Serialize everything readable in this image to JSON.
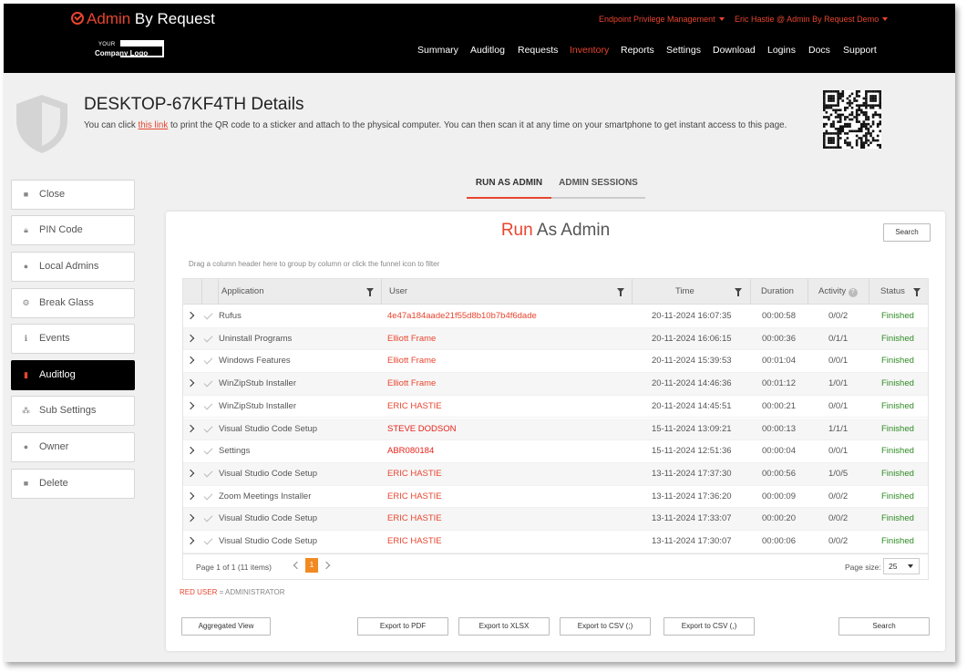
{
  "brand": {
    "name_accent": "Admin",
    "name_rest": " By Request"
  },
  "company_logo": {
    "your": "YOUR",
    "text": "Company Logo"
  },
  "top_links": {
    "product": "Endpoint Privilege Management",
    "user": "Eric Hastie @ Admin By Request Demo"
  },
  "nav": [
    "Summary",
    "Auditlog",
    "Requests",
    "Inventory",
    "Reports",
    "Settings",
    "Download",
    "Logins",
    "Docs",
    "Support"
  ],
  "nav_active": "Inventory",
  "page": {
    "title": "DESKTOP-67KF4TH Details",
    "subtitle_before": "You can click ",
    "subtitle_link": "this link",
    "subtitle_after": " to print the QR code to a sticker and attach to the physical computer. You can then scan it at any time on your smartphone to get instant access to this page."
  },
  "sidebar": [
    {
      "label": "Close",
      "icon": "square-icon"
    },
    {
      "label": "PIN Code",
      "icon": "lock-icon"
    },
    {
      "label": "Local Admins",
      "icon": "user-icon"
    },
    {
      "label": "Break Glass",
      "icon": "gears-icon"
    },
    {
      "label": "Events",
      "icon": "info-icon"
    },
    {
      "label": "Auditlog",
      "icon": "document-icon",
      "active": true
    },
    {
      "label": "Sub Settings",
      "icon": "sitemap-icon"
    },
    {
      "label": "Owner",
      "icon": "user-icon"
    },
    {
      "label": "Delete",
      "icon": "square-icon"
    }
  ],
  "tabs": [
    "RUN AS ADMIN",
    "ADMIN SESSIONS"
  ],
  "panel": {
    "title_accent": "Run",
    "title_rest": " As Admin",
    "search_label": "Search",
    "hint": "Drag a column header here to group by column or click the funnel icon to filter"
  },
  "grid": {
    "columns": {
      "application": "Application",
      "user": "User",
      "time": "Time",
      "duration": "Duration",
      "activity": "Activity",
      "status": "Status"
    },
    "rows": [
      {
        "application": "Rufus",
        "user": "4e47a184aade21f55d8b10b7b4f6dade",
        "time": "20-11-2024 16:07:35",
        "duration": "00:00:58",
        "activity": "0/0/2",
        "status": "Finished"
      },
      {
        "application": "Uninstall Programs",
        "user": "Elliott Frame",
        "time": "20-11-2024 16:06:15",
        "duration": "00:00:36",
        "activity": "0/1/1",
        "status": "Finished"
      },
      {
        "application": "Windows Features",
        "user": "Elliott Frame",
        "time": "20-11-2024 15:39:53",
        "duration": "00:01:04",
        "activity": "0/0/1",
        "status": "Finished"
      },
      {
        "application": "WinZipStub Installer",
        "user": "Elliott Frame",
        "time": "20-11-2024 14:46:36",
        "duration": "00:01:12",
        "activity": "1/0/1",
        "status": "Finished"
      },
      {
        "application": "WinZipStub Installer",
        "user": "ERIC HASTIE",
        "time": "20-11-2024 14:45:51",
        "duration": "00:00:21",
        "activity": "0/0/1",
        "status": "Finished"
      },
      {
        "application": "Visual Studio Code Setup",
        "user": "STEVE DODSON",
        "time": "15-11-2024 13:09:21",
        "duration": "00:00:13",
        "activity": "1/1/1",
        "status": "Finished"
      },
      {
        "application": "Settings",
        "user": "ABR080184",
        "time": "15-11-2024 12:51:36",
        "duration": "00:00:04",
        "activity": "0/0/1",
        "status": "Finished"
      },
      {
        "application": "Visual Studio Code Setup",
        "user": "ERIC HASTIE",
        "time": "13-11-2024 17:37:30",
        "duration": "00:00:56",
        "activity": "1/0/5",
        "status": "Finished"
      },
      {
        "application": "Zoom Meetings Installer",
        "user": "ERIC HASTIE",
        "time": "13-11-2024 17:36:20",
        "duration": "00:00:09",
        "activity": "0/0/2",
        "status": "Finished"
      },
      {
        "application": "Visual Studio Code Setup",
        "user": "ERIC HASTIE",
        "time": "13-11-2024 17:33:07",
        "duration": "00:00:20",
        "activity": "0/0/2",
        "status": "Finished"
      },
      {
        "application": "Visual Studio Code Setup",
        "user": "ERIC HASTIE",
        "time": "13-11-2024 17:30:07",
        "duration": "00:00:06",
        "activity": "0/0/2",
        "status": "Finished"
      }
    ],
    "pager": {
      "info": "Page 1 of 1 (11 items)",
      "current": "1",
      "size_label": "Page size:",
      "size": "25"
    }
  },
  "legend": {
    "red": "RED USER",
    "rest": " = ADMINISTRATOR"
  },
  "buttons": {
    "aggregated": "Aggregated View",
    "pdf": "Export to PDF",
    "xlsx": "Export to XLSX",
    "csv_semicolon": "Export to CSV (;)",
    "csv_comma": "Export to CSV (,)",
    "search": "Search"
  },
  "colors": {
    "accent": "#e8452f",
    "finished": "#2e8b23",
    "pager_active": "#f28a22"
  }
}
